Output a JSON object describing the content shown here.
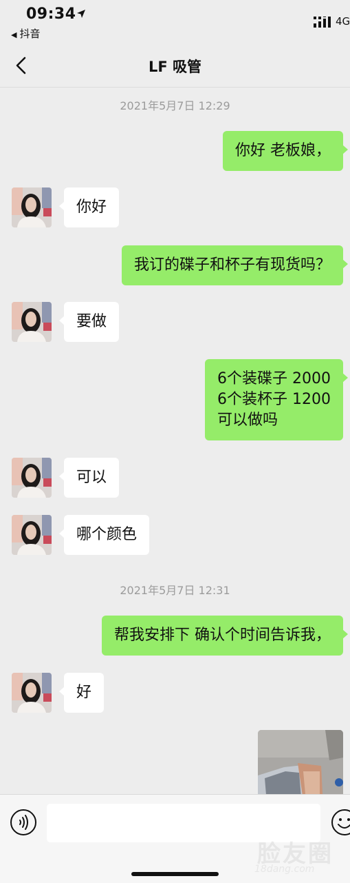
{
  "status_bar": {
    "time": "09:34",
    "back_app": "抖音",
    "network": "4G"
  },
  "header": {
    "title": "LF 吸管"
  },
  "messages": [
    {
      "type": "timestamp",
      "text": "2021年5月7日 12:29"
    },
    {
      "type": "outgoing",
      "text": "你好 老板娘，"
    },
    {
      "type": "incoming",
      "text": "你好"
    },
    {
      "type": "outgoing",
      "text": "我订的碟子和杯子有现货吗？"
    },
    {
      "type": "incoming",
      "text": "要做"
    },
    {
      "type": "outgoing",
      "text": "6个装碟子 2000\n6个装杯子 1200\n可以做吗"
    },
    {
      "type": "incoming",
      "text": "可以"
    },
    {
      "type": "incoming",
      "text": "哪个颜色"
    },
    {
      "type": "timestamp",
      "text": "2021年5月7日 12:31"
    },
    {
      "type": "outgoing",
      "text": "帮我安排下 确认个时间告诉我，"
    },
    {
      "type": "incoming",
      "text": "好"
    },
    {
      "type": "outgoing-image"
    }
  ],
  "input": {
    "value": "",
    "placeholder": ""
  },
  "watermark": {
    "big": "脸友圈",
    "small": "18dang.com"
  }
}
